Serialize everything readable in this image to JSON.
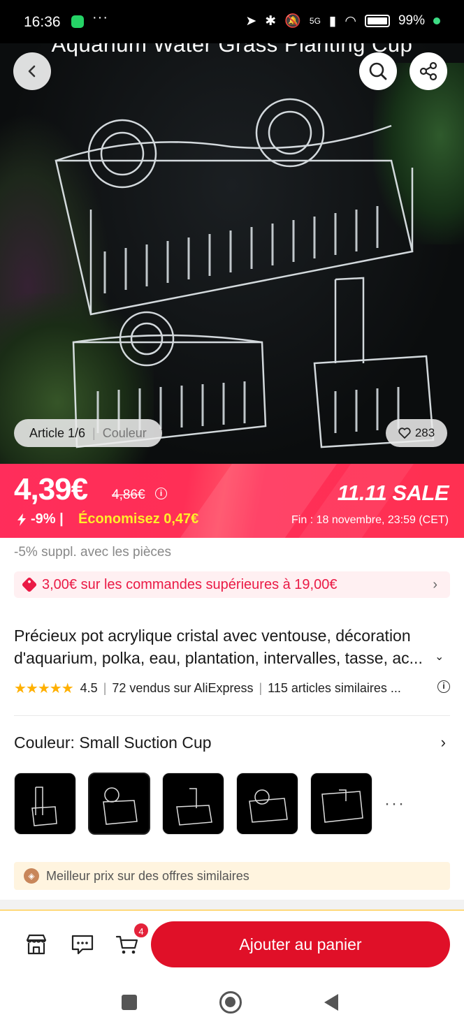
{
  "status_bar": {
    "time": "16:36",
    "dots": "···",
    "network": "5G",
    "battery": "99%"
  },
  "hero": {
    "image_title": "Aquarium Water Grass Planting Cup",
    "article_label": "Article 1/6",
    "variant_label": "Couleur",
    "likes": "283"
  },
  "price": {
    "current": "4,39€",
    "original": "4,86€",
    "discount": "-9% |",
    "savings": "Économisez 0,47€",
    "sale_label": "11.11 SALE",
    "sale_end": "Fin :  18 novembre, 23:59 (CET)",
    "coins_note": "-5% suppl. avec les pièces",
    "coupon": "3,00€ sur les commandes supérieures à 19,00€"
  },
  "product": {
    "title": "Précieux pot acrylique cristal avec ventouse, décoration d'aquarium, polka, eau, plantation, intervalles, tasse, ac...",
    "rating": "4.5",
    "stars": "★★★★★",
    "sold": "72 vendus sur AliExpress",
    "similar": "115 articles similaires ..."
  },
  "variant": {
    "label": "Couleur: Small Suction Cup",
    "more": "···"
  },
  "best_price": {
    "text": "Meilleur prix sur des offres similaires"
  },
  "bottom_bar": {
    "cart_count": "4",
    "add_to_cart": "Ajouter au panier"
  },
  "colors": {
    "accent_red": "#e01028",
    "banner_pink": "#ff2f56",
    "savings_yellow": "#ffee2a",
    "coupon_red": "#ea1a45",
    "star_gold": "#ffb000"
  }
}
